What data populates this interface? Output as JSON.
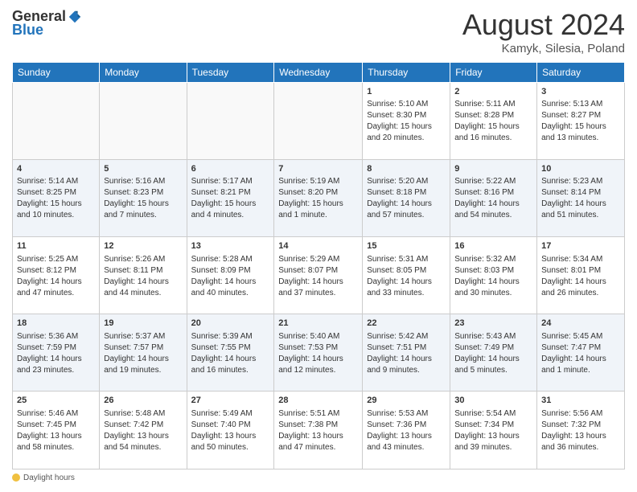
{
  "header": {
    "logo_general": "General",
    "logo_blue": "Blue",
    "title": "August 2024",
    "location": "Kamyk, Silesia, Poland"
  },
  "days_of_week": [
    "Sunday",
    "Monday",
    "Tuesday",
    "Wednesday",
    "Thursday",
    "Friday",
    "Saturday"
  ],
  "weeks": [
    [
      {
        "day": "",
        "info": ""
      },
      {
        "day": "",
        "info": ""
      },
      {
        "day": "",
        "info": ""
      },
      {
        "day": "",
        "info": ""
      },
      {
        "day": "1",
        "info": "Sunrise: 5:10 AM\nSunset: 8:30 PM\nDaylight: 15 hours and 20 minutes."
      },
      {
        "day": "2",
        "info": "Sunrise: 5:11 AM\nSunset: 8:28 PM\nDaylight: 15 hours and 16 minutes."
      },
      {
        "day": "3",
        "info": "Sunrise: 5:13 AM\nSunset: 8:27 PM\nDaylight: 15 hours and 13 minutes."
      }
    ],
    [
      {
        "day": "4",
        "info": "Sunrise: 5:14 AM\nSunset: 8:25 PM\nDaylight: 15 hours and 10 minutes."
      },
      {
        "day": "5",
        "info": "Sunrise: 5:16 AM\nSunset: 8:23 PM\nDaylight: 15 hours and 7 minutes."
      },
      {
        "day": "6",
        "info": "Sunrise: 5:17 AM\nSunset: 8:21 PM\nDaylight: 15 hours and 4 minutes."
      },
      {
        "day": "7",
        "info": "Sunrise: 5:19 AM\nSunset: 8:20 PM\nDaylight: 15 hours and 1 minute."
      },
      {
        "day": "8",
        "info": "Sunrise: 5:20 AM\nSunset: 8:18 PM\nDaylight: 14 hours and 57 minutes."
      },
      {
        "day": "9",
        "info": "Sunrise: 5:22 AM\nSunset: 8:16 PM\nDaylight: 14 hours and 54 minutes."
      },
      {
        "day": "10",
        "info": "Sunrise: 5:23 AM\nSunset: 8:14 PM\nDaylight: 14 hours and 51 minutes."
      }
    ],
    [
      {
        "day": "11",
        "info": "Sunrise: 5:25 AM\nSunset: 8:12 PM\nDaylight: 14 hours and 47 minutes."
      },
      {
        "day": "12",
        "info": "Sunrise: 5:26 AM\nSunset: 8:11 PM\nDaylight: 14 hours and 44 minutes."
      },
      {
        "day": "13",
        "info": "Sunrise: 5:28 AM\nSunset: 8:09 PM\nDaylight: 14 hours and 40 minutes."
      },
      {
        "day": "14",
        "info": "Sunrise: 5:29 AM\nSunset: 8:07 PM\nDaylight: 14 hours and 37 minutes."
      },
      {
        "day": "15",
        "info": "Sunrise: 5:31 AM\nSunset: 8:05 PM\nDaylight: 14 hours and 33 minutes."
      },
      {
        "day": "16",
        "info": "Sunrise: 5:32 AM\nSunset: 8:03 PM\nDaylight: 14 hours and 30 minutes."
      },
      {
        "day": "17",
        "info": "Sunrise: 5:34 AM\nSunset: 8:01 PM\nDaylight: 14 hours and 26 minutes."
      }
    ],
    [
      {
        "day": "18",
        "info": "Sunrise: 5:36 AM\nSunset: 7:59 PM\nDaylight: 14 hours and 23 minutes."
      },
      {
        "day": "19",
        "info": "Sunrise: 5:37 AM\nSunset: 7:57 PM\nDaylight: 14 hours and 19 minutes."
      },
      {
        "day": "20",
        "info": "Sunrise: 5:39 AM\nSunset: 7:55 PM\nDaylight: 14 hours and 16 minutes."
      },
      {
        "day": "21",
        "info": "Sunrise: 5:40 AM\nSunset: 7:53 PM\nDaylight: 14 hours and 12 minutes."
      },
      {
        "day": "22",
        "info": "Sunrise: 5:42 AM\nSunset: 7:51 PM\nDaylight: 14 hours and 9 minutes."
      },
      {
        "day": "23",
        "info": "Sunrise: 5:43 AM\nSunset: 7:49 PM\nDaylight: 14 hours and 5 minutes."
      },
      {
        "day": "24",
        "info": "Sunrise: 5:45 AM\nSunset: 7:47 PM\nDaylight: 14 hours and 1 minute."
      }
    ],
    [
      {
        "day": "25",
        "info": "Sunrise: 5:46 AM\nSunset: 7:45 PM\nDaylight: 13 hours and 58 minutes."
      },
      {
        "day": "26",
        "info": "Sunrise: 5:48 AM\nSunset: 7:42 PM\nDaylight: 13 hours and 54 minutes."
      },
      {
        "day": "27",
        "info": "Sunrise: 5:49 AM\nSunset: 7:40 PM\nDaylight: 13 hours and 50 minutes."
      },
      {
        "day": "28",
        "info": "Sunrise: 5:51 AM\nSunset: 7:38 PM\nDaylight: 13 hours and 47 minutes."
      },
      {
        "day": "29",
        "info": "Sunrise: 5:53 AM\nSunset: 7:36 PM\nDaylight: 13 hours and 43 minutes."
      },
      {
        "day": "30",
        "info": "Sunrise: 5:54 AM\nSunset: 7:34 PM\nDaylight: 13 hours and 39 minutes."
      },
      {
        "day": "31",
        "info": "Sunrise: 5:56 AM\nSunset: 7:32 PM\nDaylight: 13 hours and 36 minutes."
      }
    ]
  ],
  "footer": {
    "daylight_label": "Daylight hours"
  }
}
